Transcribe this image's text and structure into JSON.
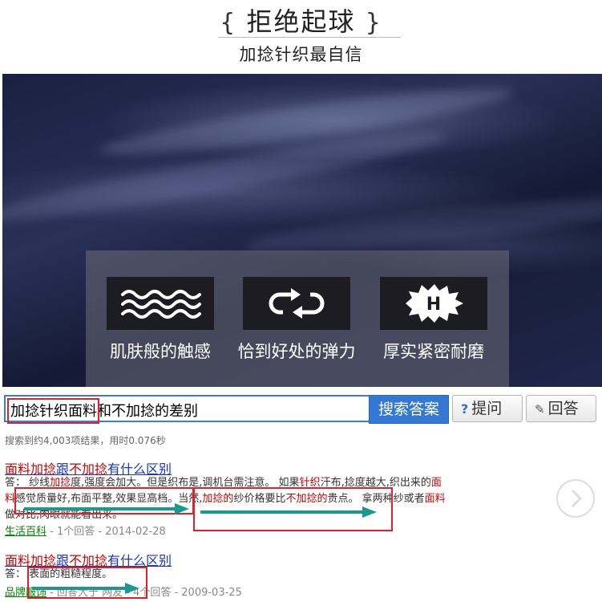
{
  "header": {
    "title_left": "{",
    "title": "拒绝起球",
    "title_right": "}",
    "subtitle": "加捻针织最自信"
  },
  "features": [
    {
      "label": "肌肤般的触感",
      "icon": "waves-icon"
    },
    {
      "label": "恰到好处的弹力",
      "icon": "stretch-arrows-icon"
    },
    {
      "label": "厚实紧密耐磨",
      "icon": "durable-h-icon"
    }
  ],
  "search": {
    "query": "加捻针织面料和不加捻的差别",
    "button": "搜索答案",
    "ask": "提问",
    "answer": "回答",
    "result_count": "搜索到约4,003项结果，用时0.076秒"
  },
  "results": [
    {
      "title_parts": [
        {
          "text": "面料加捻",
          "hl": true
        },
        {
          "text": "跟",
          "hl": false
        },
        {
          "text": "不加捻",
          "hl": true
        },
        {
          "text": "有什么区别",
          "hl": false
        }
      ],
      "line1_parts": [
        {
          "text": "答：  纱线",
          "hl": false
        },
        {
          "text": "加捻",
          "hl": true
        },
        {
          "text": "度,强度会加大。但是织布是,调机台需注意。  如果",
          "hl": false
        },
        {
          "text": "针织",
          "hl": true
        },
        {
          "text": "汗布,捻度越大,织出来的",
          "hl": false
        },
        {
          "text": "面",
          "hl": true
        }
      ],
      "line2_parts": [
        {
          "text": "料",
          "hl": true
        },
        {
          "text": "感觉质量好,布面平整,效果显高档。当然,",
          "hl": false
        },
        {
          "text": "加捻的",
          "hl": true
        },
        {
          "text": "纱价格要比",
          "hl": false
        },
        {
          "text": "不加捻的",
          "hl": true
        },
        {
          "text": "贵点。  拿两种纱或者",
          "hl": false
        },
        {
          "text": "面料",
          "hl": true
        }
      ],
      "line3": "做对比,肉眼就能看出来。",
      "category": "生活百科",
      "meta": " - 1个回答 - 2014-02-28"
    },
    {
      "title_parts": [
        {
          "text": "面料加捻",
          "hl": true
        },
        {
          "text": "跟",
          "hl": false
        },
        {
          "text": "不加捻",
          "hl": true
        },
        {
          "text": "有什么区别",
          "hl": false
        }
      ],
      "line1": "答：  表面的粗糙程度。",
      "category": "品牌服饰",
      "meta": " - 回答大于 网友 - 4个回答 - 2009-03-25"
    }
  ],
  "colors": {
    "accent": "#3478d6",
    "highlight": "#cc0000",
    "annotation_box": "#e0202a",
    "annotation_arrow": "#1a9a8a"
  }
}
